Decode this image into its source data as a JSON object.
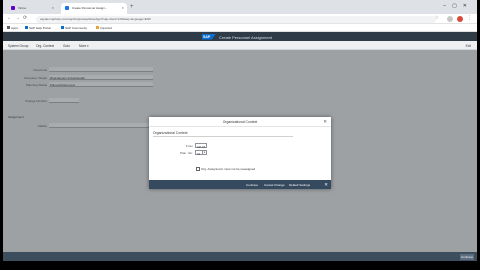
{
  "browser": {
    "tabs": [
      {
        "label": "Yahoo"
      },
      {
        "label": "Create Personnel Assign..."
      }
    ],
    "new_tab": "+",
    "window_controls": "–▢✕",
    "address": "sapdev.saphelp.com/sap/bc/gui/sap/its/webgui?sap-client=100&sap-language=EN#",
    "nav": {
      "back": "←",
      "forward": "→",
      "reload": "⟳"
    },
    "bookmarks": [
      {
        "label": "Apps"
      },
      {
        "label": "SAP Help Portal"
      },
      {
        "label": "SAP Community"
      },
      {
        "label": "Imported"
      }
    ]
  },
  "sap": {
    "logo_text": "SAP",
    "title": "Create Personnel Assignment",
    "menu": [
      "System Group",
      "Org. Context",
      "Goto",
      "More ▾"
    ],
    "exit": "Exit",
    "fields": [
      {
        "label": "Personnel",
        "value": ""
      },
      {
        "label": "Company / Regio",
        "value": "Rheinlangen Industriepark"
      },
      {
        "label": "Planning Status",
        "value": "Planned/Approved"
      },
      {
        "label": "Change Number",
        "value": ""
      }
    ],
    "group_label": "Assignment",
    "group_field_label": "Validity",
    "group_field_value": ""
  },
  "dialog": {
    "title": "Organizational Context",
    "close": "✕",
    "group": "Organizational Context",
    "from_label": "From",
    "from_value": "CP-01",
    "to_label": "Plan. Ver.",
    "to_value": "01",
    "f4": "▾",
    "checkbox_label": "Org. Assignment must not be reassigned",
    "footer_buttons": [
      "Continue",
      "Cancel Change",
      "Default Settings"
    ],
    "footer_close": "✕"
  },
  "status": {
    "button": "Continue"
  },
  "colors": {
    "shell": "#2f3c48",
    "content": "#b8bcc0",
    "dialog_footer": "#354a5f",
    "accent": "#0a6ed1"
  }
}
